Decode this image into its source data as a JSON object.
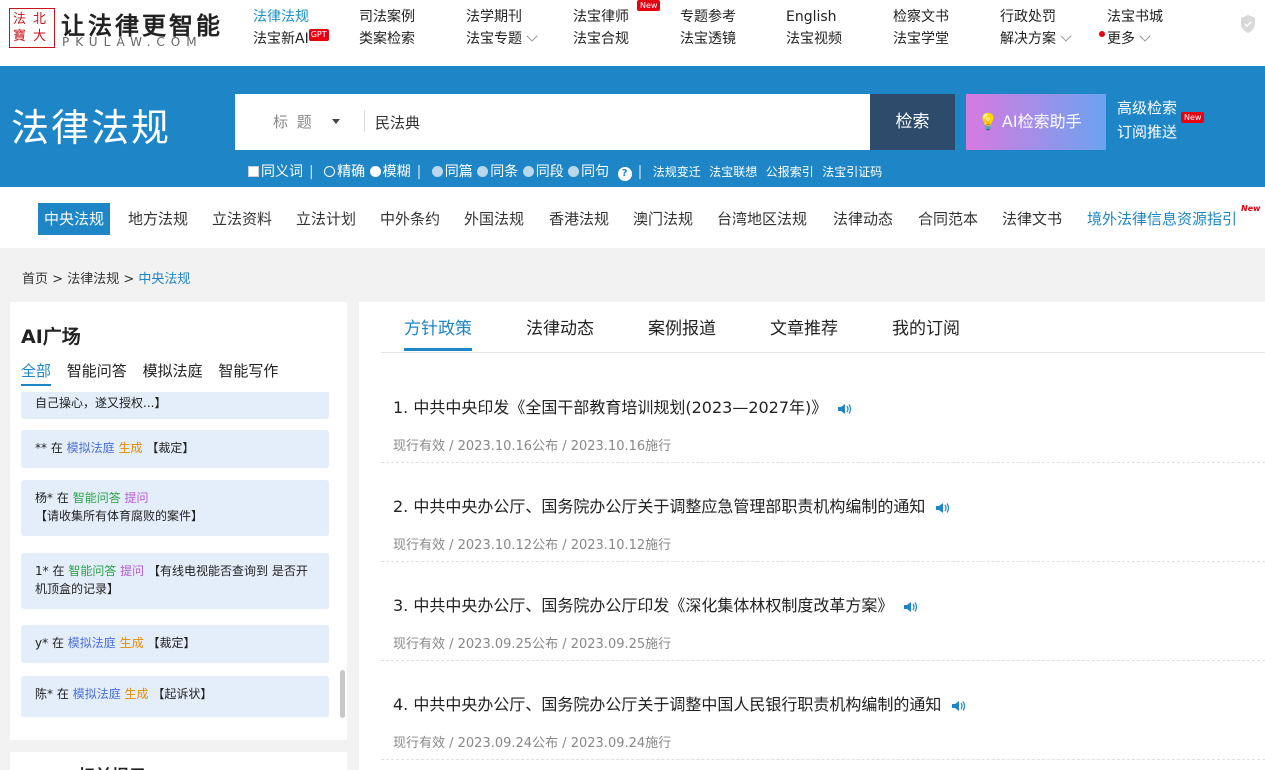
{
  "logo": {
    "seal": [
      "法",
      "北",
      "寶",
      "大"
    ],
    "slogan": "让法律更智能",
    "domain": "PKULAW.COM"
  },
  "topnav": {
    "columns": [
      {
        "top": "法律法规",
        "bottom": "法宝新AI",
        "bottom_badge": "GPT"
      },
      {
        "top": "司法案例",
        "bottom": "类案检索"
      },
      {
        "top": "法学期刊",
        "bottom": "法宝专题"
      },
      {
        "top": "法宝律师",
        "bottom": "法宝合规",
        "top_badge": "New"
      },
      {
        "top": "专题参考",
        "bottom": "法宝透镜"
      },
      {
        "top": "English",
        "bottom": "法宝视频"
      },
      {
        "top": "检察文书",
        "bottom": "法宝学堂"
      },
      {
        "top": "行政处罚",
        "bottom": "解决方案"
      },
      {
        "top": "法宝书城",
        "bottom": "更多"
      }
    ]
  },
  "hero": {
    "title": "法律法规",
    "search_type": "标 题",
    "search_value": "民法典",
    "search_button": "检索",
    "ai_button": "AI检索助手",
    "advanced_search": "高级检索",
    "advanced_badge": "New",
    "subscribe": "订阅推送",
    "options": {
      "synonym": "同义词",
      "exact": "精确",
      "fuzzy": "模糊",
      "same_article": "同篇",
      "same_clause": "同条",
      "same_paragraph": "同段",
      "same_sentence": "同句",
      "help": "?",
      "links": [
        "法规变迁",
        "法宝联想",
        "公报索引",
        "法宝引证码"
      ]
    }
  },
  "categories": {
    "items": [
      "中央法规",
      "地方法规",
      "立法资料",
      "立法计划",
      "中外条约",
      "外国法规",
      "香港法规",
      "澳门法规",
      "台湾地区法规",
      "法律动态",
      "合同范本",
      "法律文书",
      "境外法律信息资源指引"
    ],
    "badge": "New"
  },
  "breadcrumb": [
    "首页",
    "法律法规",
    "中央法规"
  ],
  "ai_square": {
    "title": "AI广场",
    "tabs": [
      "全部",
      "智能问答",
      "模拟法庭",
      "智能写作"
    ],
    "feed": [
      {
        "text": "自己操心，遂又授权...】"
      },
      {
        "user": "**",
        "in": "在",
        "module": "模拟法庭",
        "action": "生成",
        "content": "【裁定】"
      },
      {
        "user": "杨*",
        "in": "在",
        "module": "智能问答",
        "action": "提问",
        "content": "【请收集所有体育腐败的案件】"
      },
      {
        "user": "1*",
        "in": "在",
        "module": "智能问答",
        "action": "提问",
        "content": "【有线电视能否查询到 是否开机顶盒的记录】"
      },
      {
        "user": "y*",
        "in": "在",
        "module": "模拟法庭",
        "action": "生成",
        "content": "【裁定】"
      },
      {
        "user": "陈*",
        "in": "在",
        "module": "模拟法庭",
        "action": "生成",
        "content": "【起诉状】"
      }
    ],
    "next_panel_title": "标前提示"
  },
  "main_tabs": [
    "方针政策",
    "法律动态",
    "案例报道",
    "文章推荐",
    "我的订阅"
  ],
  "news": [
    {
      "title": "1. 中共中央印发《全国干部教育培训规划(2023—2027年)》",
      "meta": "现行有效 / 2023.10.16公布 / 2023.10.16施行"
    },
    {
      "title": "2. 中共中央办公厅、国务院办公厅关于调整应急管理部职责机构编制的通知",
      "meta": "现行有效 / 2023.10.12公布 / 2023.10.12施行"
    },
    {
      "title": "3. 中共中央办公厅、国务院办公厅印发《深化集体林权制度改革方案》",
      "meta": "现行有效 / 2023.09.25公布 / 2023.09.25施行"
    },
    {
      "title": "4. 中共中央办公厅、国务院办公厅关于调整中国人民银行职责机构编制的通知",
      "meta": "现行有效 / 2023.09.24公布 / 2023.09.24施行"
    }
  ],
  "colors": {
    "brand_blue": "#1e86c6",
    "search_button": "#2d4b6b",
    "badge_red": "#e60012"
  }
}
